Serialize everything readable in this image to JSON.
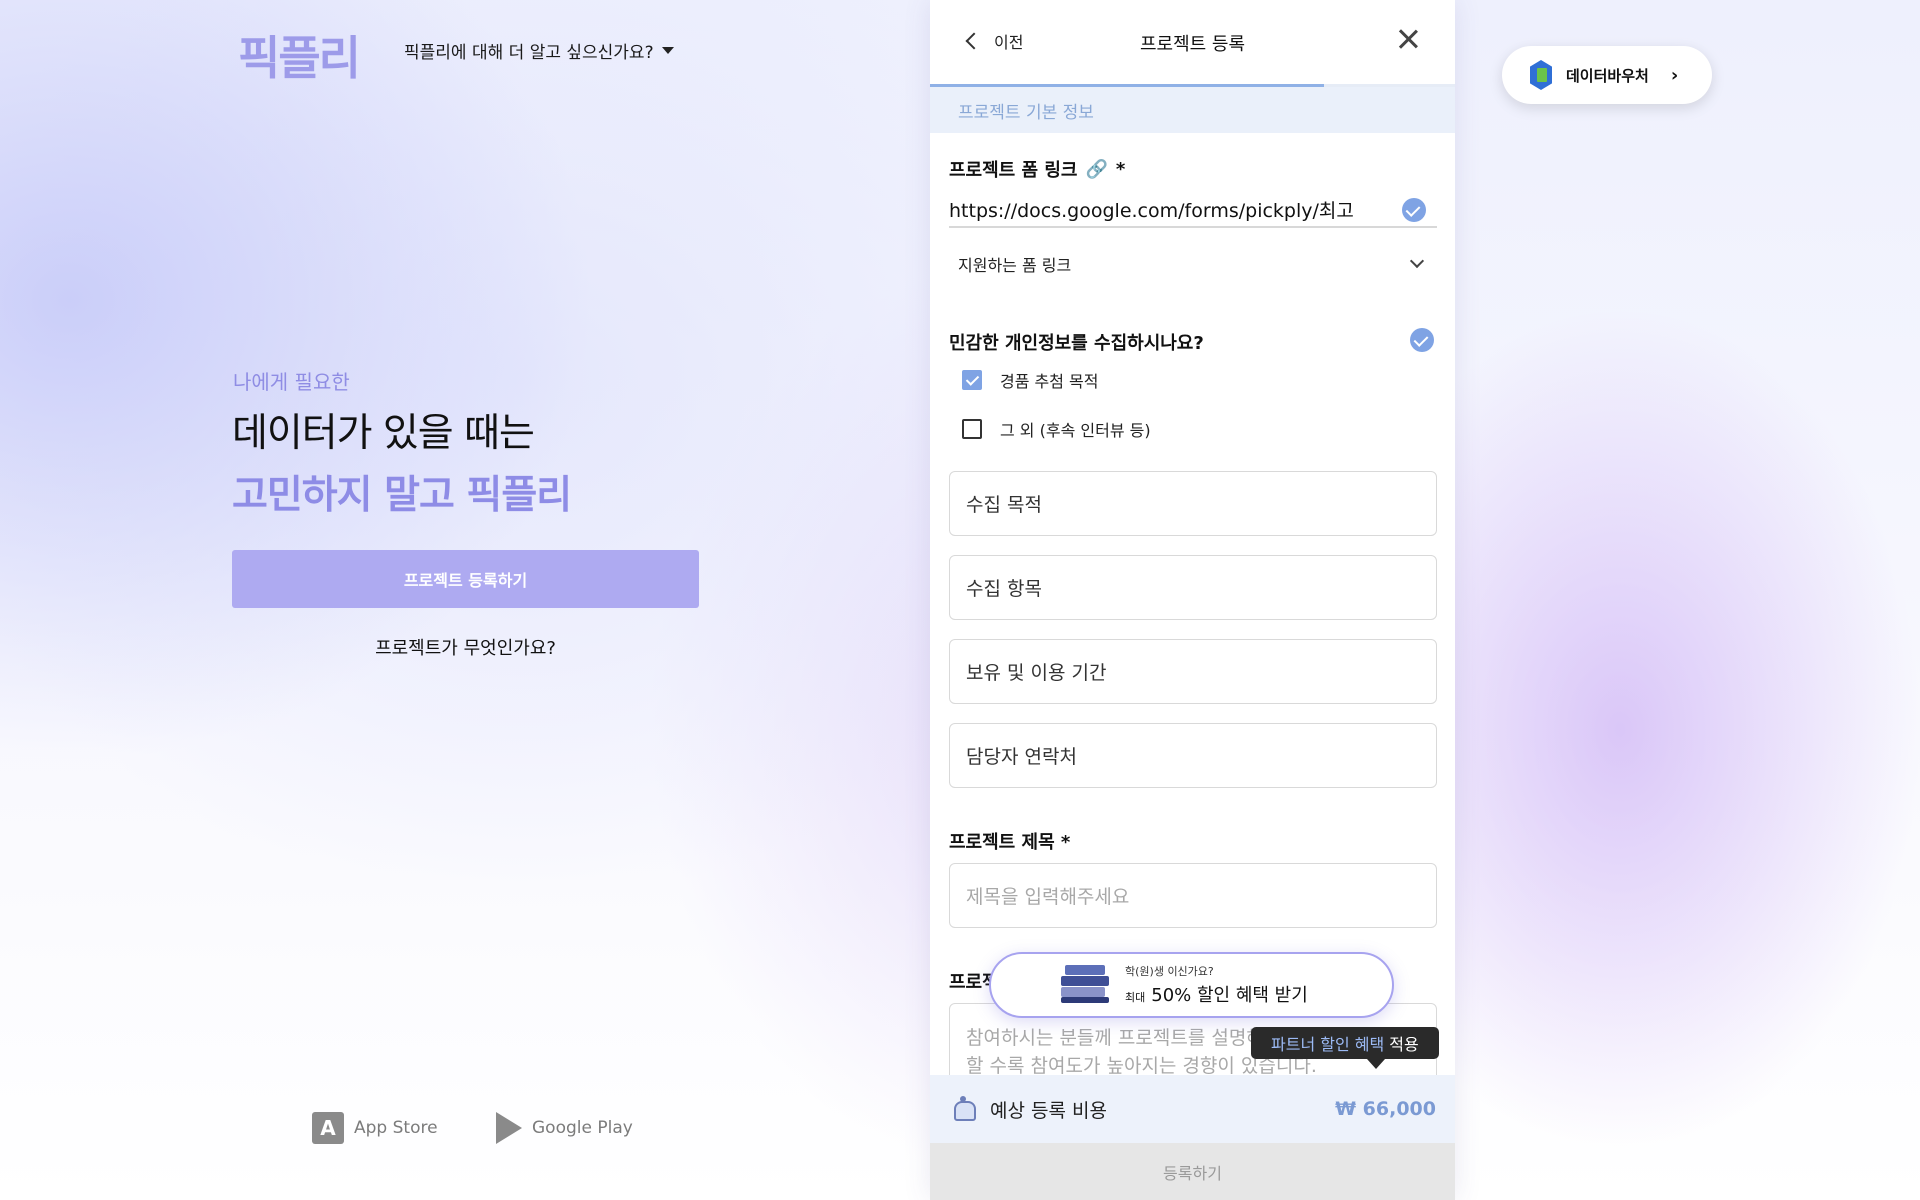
{
  "brand": {
    "logo_text": "픽플리"
  },
  "nav": {
    "about_label": "픽플리에 대해 더 알고 싶으신가요?"
  },
  "hero": {
    "subtitle": "나에게 필요한",
    "line1": "데이터가 있을 때는",
    "line2": "고민하지 말고 픽플리",
    "cta_label": "프로젝트 등록하기",
    "link_label": "프로젝트가 무엇인가요?"
  },
  "stores": {
    "app_store": "App Store",
    "google_play": "Google Play"
  },
  "voucher": {
    "label": "데이터바우처"
  },
  "modal": {
    "back_label": "이전",
    "title": "프로젝트 등록",
    "progress": 0.75,
    "section": "프로젝트 기본 정보",
    "form_link_label": "프로젝트 폼 링크",
    "required_mark": "*",
    "form_link_value": "https://docs.google.com/forms/pickply/최고",
    "supported_forms_label": "지원하는 폼 링크",
    "sensitive_question": "민감한 개인정보를 수집하시나요?",
    "options": [
      {
        "label": "경품 추첨 목적",
        "checked": true
      },
      {
        "label": "그 외 (후속 인터뷰 등)",
        "checked": false
      }
    ],
    "fields": [
      "수집 목적",
      "수집 항목",
      "보유 및 이용 기간",
      "담당자 연락처"
    ],
    "title_label": "프로젝트 제목 *",
    "title_placeholder": "제목을 입력해주세요",
    "desc_label_partial": "프로젝",
    "desc_placeholder_line1": "참여하시는 분들께 프로젝트를 설명해",
    "desc_placeholder_line2": "할 수록 참여도가 높아지는 경향이 있습니다.",
    "promo": {
      "small": "학(원)생 이신가요?",
      "tiny": "최대",
      "big": "50% 할인 혜택 받기"
    },
    "tooltip": {
      "highlight": "파트너 할인 혜택",
      "rest": "적용"
    },
    "cost_label": "예상 등록 비용",
    "cost_value": "₩ 66,000",
    "submit_label": "등록하기"
  },
  "colors": {
    "brand": "#9d9be9",
    "cta": "#aeaaf1",
    "accent_blue": "#7fa3e4",
    "cost_value": "#7b9ad3"
  },
  "icons": [
    "caret-down-icon",
    "apple-app-store-icon",
    "google-play-icon",
    "data-voucher-logo-icon",
    "chevron-right-icon",
    "chevron-left-icon",
    "close-icon",
    "link-icon",
    "check-circle-icon",
    "chevron-down-icon",
    "books-icon",
    "cost-icon"
  ]
}
